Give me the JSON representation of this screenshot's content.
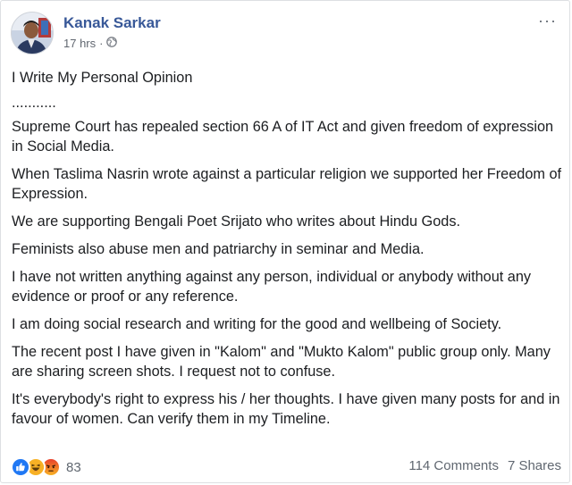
{
  "post": {
    "author": "Kanak Sarkar",
    "time": "17 hrs",
    "separator": "·",
    "privacy_icon": "globe-icon",
    "more_icon": "ellipsis-icon",
    "paragraphs": [
      "I Write My Personal Opinion",
      "...........",
      "Supreme Court has repealed section 66 A of IT Act and given freedom of expression in Social Media.",
      "When Taslima Nasrin wrote against a particular religion we supported her Freedom of Expression.",
      "We are supporting Bengali Poet Srijato who writes about Hindu Gods.",
      "Feminists also abuse men and patriarchy in seminar and Media.",
      "I have not written anything against any person, individual or anybody without any evidence or proof or any reference.",
      "I am doing social research and writing for the good and wellbeing of Society.",
      "The recent post I have given in \"Kalom\" and \"Mukto Kalom\" public group only. Many are sharing screen shots. I request not to confuse.",
      "It's everybody's right to express his / her thoughts. I have given many posts for and in favour of women. Can verify them in my Timeline."
    ]
  },
  "footer": {
    "reaction_icons": [
      "like-icon",
      "haha-icon",
      "angry-icon"
    ],
    "reaction_count": "83",
    "comments": "114 Comments",
    "shares": "7 Shares"
  },
  "colors": {
    "author_link": "#385898",
    "like": "#2078f4",
    "haha": "#f7b125",
    "angry": "#e9710f"
  }
}
